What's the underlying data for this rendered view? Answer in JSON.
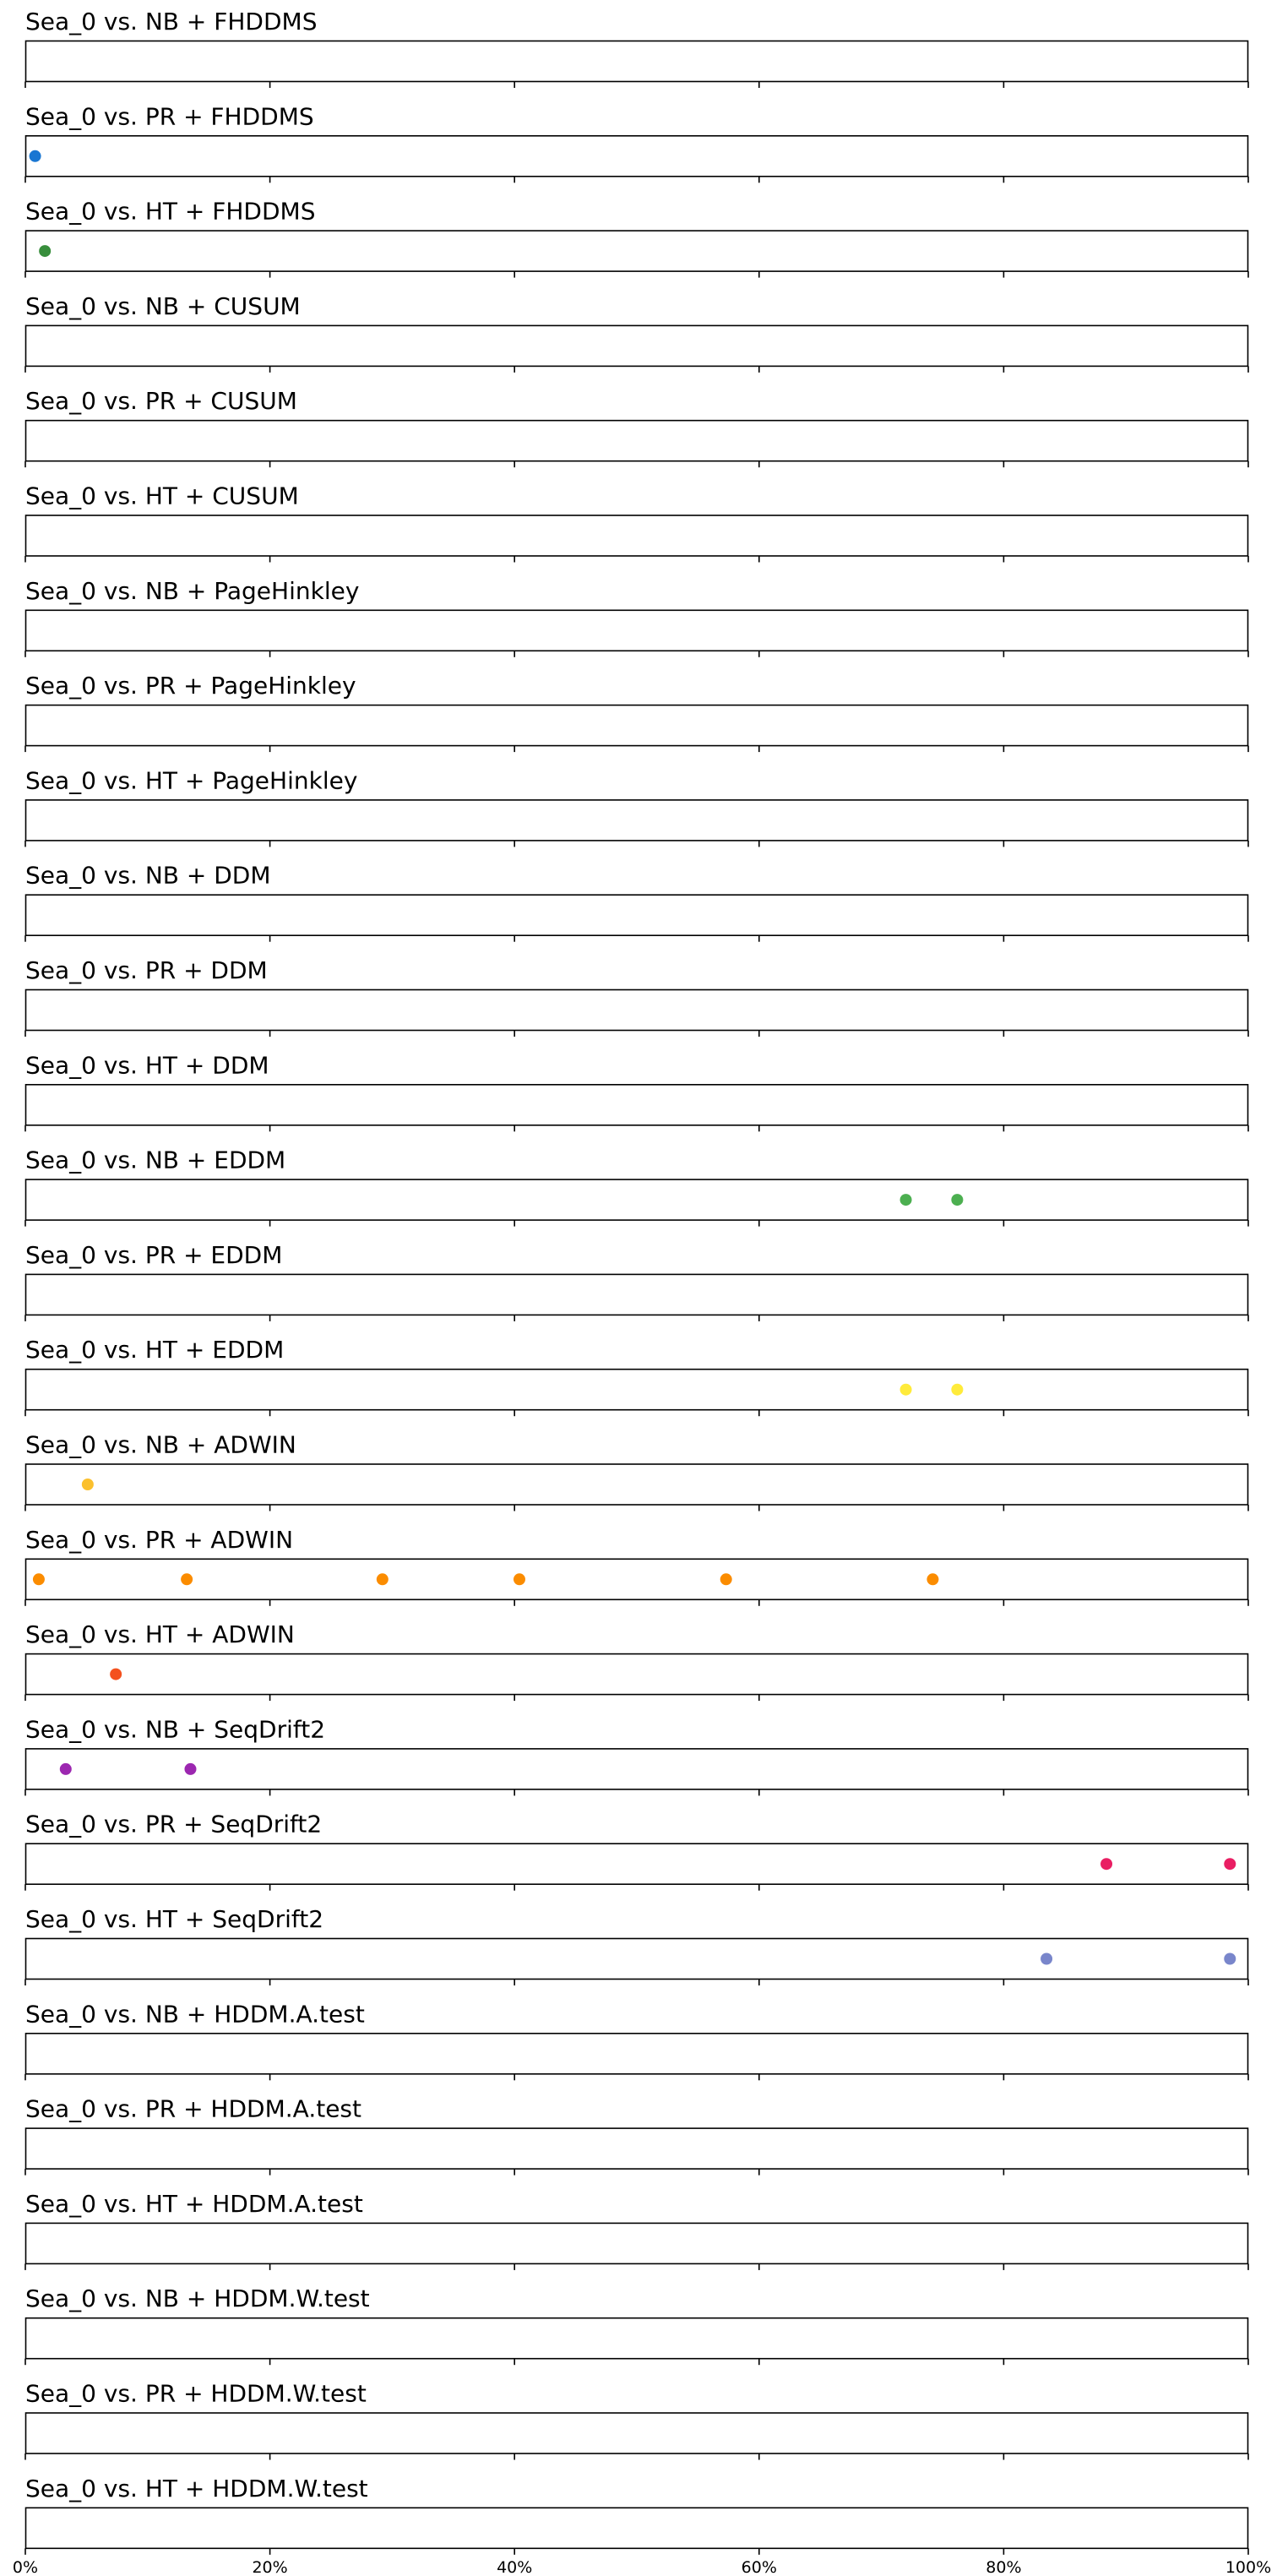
{
  "chart_data": {
    "type": "scatter",
    "xlim": [
      0,
      100
    ],
    "x_tick_labels": [
      "0%",
      "20%",
      "40%",
      "60%",
      "80%",
      "100%"
    ],
    "x_ticks": [
      0,
      20,
      40,
      60,
      80,
      100
    ],
    "grid": false,
    "panels": [
      {
        "title": "Sea_0 vs. NB + FHDDMS",
        "color": "#1565c0",
        "x": []
      },
      {
        "title": "Sea_0 vs. PR + FHDDMS",
        "color": "#1976d2",
        "x": [
          0.8
        ]
      },
      {
        "title": "Sea_0 vs. HT + FHDDMS",
        "color": "#388e3c",
        "x": [
          1.6
        ]
      },
      {
        "title": "Sea_0 vs. NB + CUSUM",
        "color": "#1976d2",
        "x": []
      },
      {
        "title": "Sea_0 vs. PR + CUSUM",
        "color": "#1976d2",
        "x": []
      },
      {
        "title": "Sea_0 vs. HT + CUSUM",
        "color": "#1976d2",
        "x": []
      },
      {
        "title": "Sea_0 vs. NB + PageHinkley",
        "color": "#1976d2",
        "x": []
      },
      {
        "title": "Sea_0 vs. PR + PageHinkley",
        "color": "#1976d2",
        "x": []
      },
      {
        "title": "Sea_0 vs. HT + PageHinkley",
        "color": "#1976d2",
        "x": []
      },
      {
        "title": "Sea_0 vs. NB + DDM",
        "color": "#1976d2",
        "x": []
      },
      {
        "title": "Sea_0 vs. PR + DDM",
        "color": "#1976d2",
        "x": []
      },
      {
        "title": "Sea_0 vs. HT + DDM",
        "color": "#1976d2",
        "x": []
      },
      {
        "title": "Sea_0 vs. NB + EDDM",
        "color": "#4caf50",
        "x": [
          72.0,
          76.2
        ]
      },
      {
        "title": "Sea_0 vs. PR + EDDM",
        "color": "#1976d2",
        "x": []
      },
      {
        "title": "Sea_0 vs. HT + EDDM",
        "color": "#ffeb3b",
        "x": [
          72.0,
          76.2
        ]
      },
      {
        "title": "Sea_0 vs. NB + ADWIN",
        "color": "#fbc02d",
        "x": [
          5.1
        ]
      },
      {
        "title": "Sea_0 vs. PR + ADWIN",
        "color": "#fb8c00",
        "x": [
          1.1,
          13.2,
          29.2,
          40.4,
          57.3,
          74.2
        ]
      },
      {
        "title": "Sea_0 vs. HT + ADWIN",
        "color": "#f4511e",
        "x": [
          7.4
        ]
      },
      {
        "title": "Sea_0 vs. NB + SeqDrift2",
        "color": "#9c27b0",
        "x": [
          3.3,
          13.5
        ]
      },
      {
        "title": "Sea_0 vs. PR + SeqDrift2",
        "color": "#e91e63",
        "x": [
          88.4,
          98.5
        ]
      },
      {
        "title": "Sea_0 vs. HT + SeqDrift2",
        "color": "#7986cb",
        "x": [
          83.5,
          98.5
        ]
      },
      {
        "title": "Sea_0 vs. NB + HDDM.A.test",
        "color": "#1976d2",
        "x": []
      },
      {
        "title": "Sea_0 vs. PR + HDDM.A.test",
        "color": "#1976d2",
        "x": []
      },
      {
        "title": "Sea_0 vs. HT + HDDM.A.test",
        "color": "#1976d2",
        "x": []
      },
      {
        "title": "Sea_0 vs. NB + HDDM.W.test",
        "color": "#1976d2",
        "x": []
      },
      {
        "title": "Sea_0 vs. PR + HDDM.W.test",
        "color": "#1976d2",
        "x": []
      },
      {
        "title": "Sea_0 vs. HT + HDDM.W.test",
        "color": "#1976d2",
        "x": []
      }
    ]
  }
}
